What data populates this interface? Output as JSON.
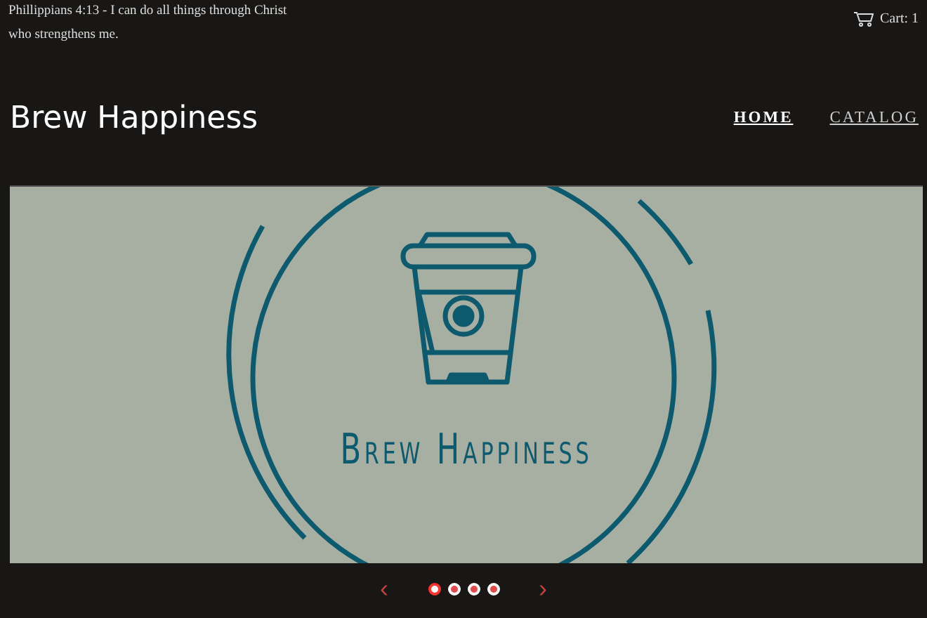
{
  "announcement": "Phillippians 4:13 - I can do all things through Christ who strengthens me.",
  "cart": {
    "label": "Cart: 1"
  },
  "site_title": "Brew Happiness",
  "nav": [
    {
      "label": "HOME",
      "selected": true
    },
    {
      "label": "CATALOG",
      "selected": false
    }
  ],
  "slideshow": {
    "logo_text": "Brew Happiness",
    "prev": "‹",
    "next": "›",
    "dots": [
      {
        "selected": true
      },
      {
        "selected": false
      },
      {
        "selected": false
      },
      {
        "selected": false
      }
    ]
  }
}
